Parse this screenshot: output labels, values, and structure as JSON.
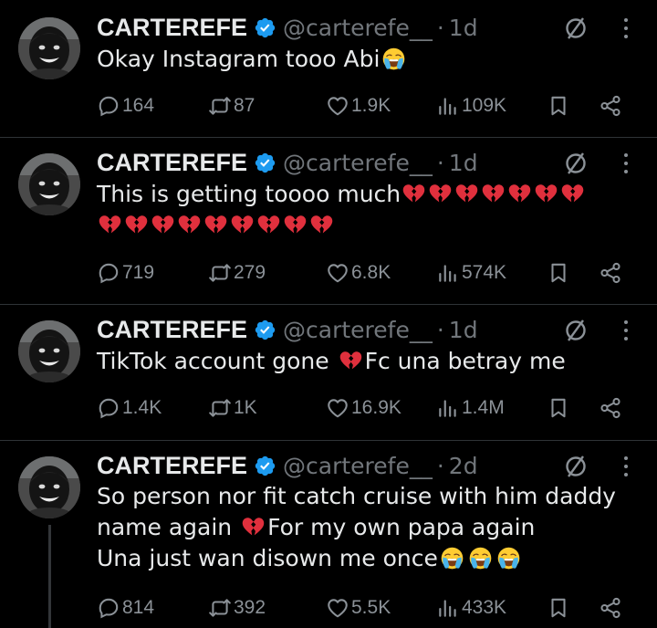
{
  "tweets": [
    {
      "name": "CARTEREFE",
      "handle": "@carterefe__",
      "time": "1d",
      "text_parts": [
        "Okay Instagram tooo Abi"
      ],
      "emojis": [
        "loudly-crying"
      ],
      "replies": "164",
      "retweets": "87",
      "likes": "1.9K",
      "views": "109K"
    },
    {
      "name": "CARTEREFE",
      "handle": "@carterefe__",
      "time": "1d",
      "text_parts": [
        "This is getting toooo much"
      ],
      "emojis": [
        "broken-heart"
      ],
      "broken_hearts_line1": 7,
      "broken_hearts_line2": 9,
      "replies": "719",
      "retweets": "279",
      "likes": "6.8K",
      "views": "574K"
    },
    {
      "name": "CARTEREFE",
      "handle": "@carterefe__",
      "time": "1d",
      "text_before": "TikTok account gone ",
      "text_after": "Fc una betray me",
      "emojis": [
        "broken-heart"
      ],
      "replies": "1.4K",
      "retweets": "1K",
      "likes": "16.9K",
      "views": "1.4M"
    },
    {
      "name": "CARTEREFE",
      "handle": "@carterefe__",
      "time": "2d",
      "line1": "So person nor fit catch cruise with him daddy",
      "line2_before": "name again ",
      "line2_after": "For my own papa again",
      "line3": "Una just wan disown me once",
      "emojis": [
        "broken-heart",
        "loudly-crying"
      ],
      "replies": "814",
      "retweets": "392",
      "likes": "5.5K",
      "views": "433K"
    }
  ],
  "colors": {
    "background": "#000000",
    "text": "#e7e9ea",
    "muted": "#71767b",
    "verified": "#1d9bf0",
    "divider": "#2f3336",
    "broken_heart": "#e0303d"
  },
  "icons": [
    "verified-badge-icon",
    "grok-icon",
    "more-icon",
    "reply-icon",
    "retweet-icon",
    "like-icon",
    "views-icon",
    "bookmark-icon",
    "share-icon",
    "broken-heart-emoji",
    "crying-emoji"
  ]
}
